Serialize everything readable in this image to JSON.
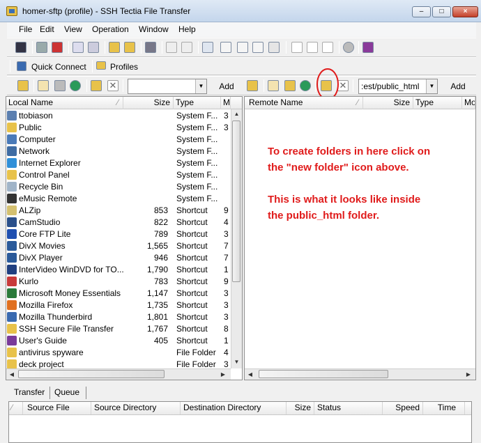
{
  "window": {
    "title": "homer-sftp (profile) - SSH Tectia File Transfer",
    "minimize": "–",
    "maximize": "□",
    "close": "×"
  },
  "menu": [
    "File",
    "Edit",
    "View",
    "Operation",
    "Window",
    "Help"
  ],
  "quickbar": {
    "quick_connect": "Quick Connect",
    "profiles": "Profiles"
  },
  "local": {
    "path_value": "",
    "add_label": "Add",
    "columns": [
      "Local Name",
      "Size",
      "Type",
      "M"
    ],
    "sort_mark": "⁄",
    "rows": [
      {
        "name": "ttobiason",
        "size": "",
        "type": "System F...",
        "m": "3",
        "icon": "user-folder-icon",
        "color": "#5b7fb0"
      },
      {
        "name": "Public",
        "size": "",
        "type": "System F...",
        "m": "3",
        "icon": "folder-icon",
        "color": "#e8c24a"
      },
      {
        "name": "Computer",
        "size": "",
        "type": "System F...",
        "m": "",
        "icon": "computer-icon",
        "color": "#4a7ab8"
      },
      {
        "name": "Network",
        "size": "",
        "type": "System F...",
        "m": "",
        "icon": "network-icon",
        "color": "#3f6ca3"
      },
      {
        "name": "Internet Explorer",
        "size": "",
        "type": "System F...",
        "m": "",
        "icon": "internet-explorer-icon",
        "color": "#2f8fd8"
      },
      {
        "name": "Control Panel",
        "size": "",
        "type": "System F...",
        "m": "",
        "icon": "control-panel-icon",
        "color": "#e8c24a"
      },
      {
        "name": "Recycle Bin",
        "size": "",
        "type": "System F...",
        "m": "",
        "icon": "recycle-bin-icon",
        "color": "#a0b4c8"
      },
      {
        "name": "eMusic Remote",
        "size": "",
        "type": "System F...",
        "m": "",
        "icon": "emusic-icon",
        "color": "#333333"
      },
      {
        "name": "ALZip",
        "size": "853",
        "type": "Shortcut",
        "m": "9",
        "icon": "alzip-icon",
        "color": "#d4c070"
      },
      {
        "name": "CamStudio",
        "size": "822",
        "type": "Shortcut",
        "m": "4",
        "icon": "camstudio-icon",
        "color": "#2a4f8a"
      },
      {
        "name": "Core FTP Lite",
        "size": "789",
        "type": "Shortcut",
        "m": "3",
        "icon": "coreftp-icon",
        "color": "#1f4fb0"
      },
      {
        "name": "DivX Movies",
        "size": "1,565",
        "type": "Shortcut",
        "m": "7",
        "icon": "divx-movies-icon",
        "color": "#2a5a9a"
      },
      {
        "name": "DivX Player",
        "size": "946",
        "type": "Shortcut",
        "m": "7",
        "icon": "divx-player-icon",
        "color": "#2a5a9a"
      },
      {
        "name": "InterVideo WinDVD for TO...",
        "size": "1,790",
        "type": "Shortcut",
        "m": "1",
        "icon": "windvd-icon",
        "color": "#1f3f80"
      },
      {
        "name": "Kurlo",
        "size": "783",
        "type": "Shortcut",
        "m": "9",
        "icon": "kurlo-icon",
        "color": "#c83a3a"
      },
      {
        "name": "Microsoft Money Essentials",
        "size": "1,147",
        "type": "Shortcut",
        "m": "3",
        "icon": "money-icon",
        "color": "#2a7a3a"
      },
      {
        "name": "Mozilla Firefox",
        "size": "1,735",
        "type": "Shortcut",
        "m": "3",
        "icon": "firefox-icon",
        "color": "#e07020"
      },
      {
        "name": "Mozilla Thunderbird",
        "size": "1,801",
        "type": "Shortcut",
        "m": "3",
        "icon": "thunderbird-icon",
        "color": "#3a6ab0"
      },
      {
        "name": "SSH Secure File Transfer",
        "size": "1,767",
        "type": "Shortcut",
        "m": "8",
        "icon": "ssh-icon",
        "color": "#e8c24a"
      },
      {
        "name": "User's Guide",
        "size": "405",
        "type": "Shortcut",
        "m": "1",
        "icon": "guide-icon",
        "color": "#7a3a9a"
      },
      {
        "name": "antivirus spyware",
        "size": "",
        "type": "File Folder",
        "m": "4",
        "icon": "folder-icon",
        "color": "#e8c24a"
      },
      {
        "name": "deck project",
        "size": "",
        "type": "File Folder",
        "m": "3",
        "icon": "folder-icon",
        "color": "#e8c24a"
      }
    ]
  },
  "remote": {
    "path_value": ":est/public_html",
    "add_label": "Add",
    "columns": [
      "Remote Name",
      "Size",
      "Type",
      "Mo"
    ],
    "sort_mark": "⁄"
  },
  "annotation": {
    "line1": "To create folders in here click on",
    "line2": "the \"new folder\" icon above.",
    "line3": "This is what it looks like inside",
    "line4": "the public_html folder.",
    "color": "#e01b1b"
  },
  "transfer": {
    "tabs": [
      "Transfer",
      "Queue"
    ],
    "columns": [
      "⁄",
      "Source File",
      "Source Directory",
      "Destination Directory",
      "Size",
      "Status",
      "Speed",
      "Time"
    ]
  }
}
